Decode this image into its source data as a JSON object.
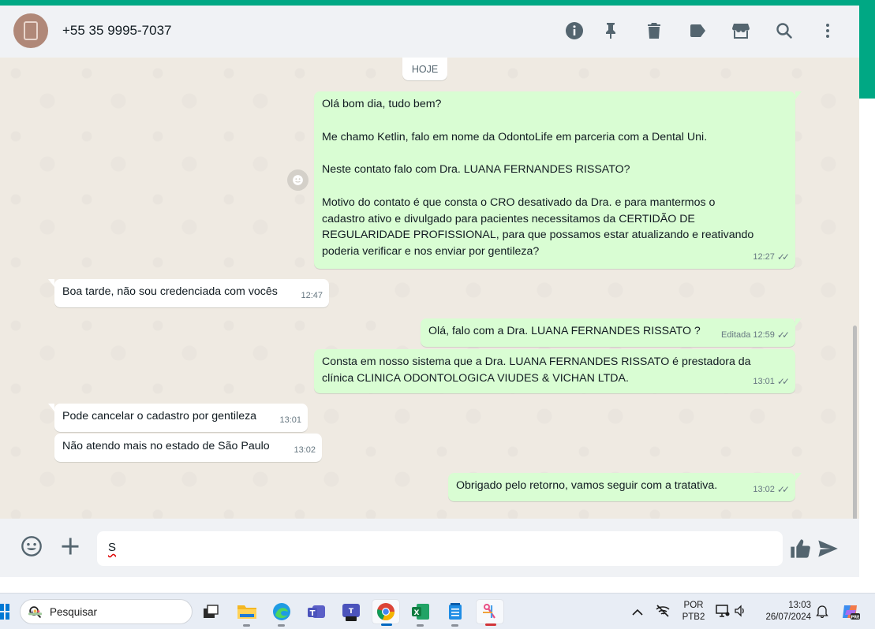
{
  "header": {
    "contact_name": "+55 35 9995-7037",
    "icons": [
      "info-icon",
      "pin-icon",
      "trash-icon",
      "label-icon",
      "store-icon",
      "search-icon",
      "more-menu-icon"
    ]
  },
  "chat": {
    "day_label": "HOJE",
    "messages": [
      {
        "direction": "outgoing",
        "lines": [
          "Olá bom dia, tudo bem?",
          "",
          "Me chamo Ketlin, falo em nome da OdontoLife em parceria com a Dental Uni.",
          "",
          "Neste contato falo com Dra. LUANA FERNANDES RISSATO?",
          "",
          "Motivo do contato é que consta o CRO desativado da Dra. e para mantermos o",
          "cadastro ativo e divulgado para pacientes necessitamos da CERTIDÃO DE",
          "REGULARIDADE PROFISSIONAL, para que possamos estar atualizando e reativando",
          "poderia verificar e nos enviar por gentileza?"
        ],
        "time": "12:27"
      },
      {
        "direction": "incoming",
        "text": "Boa tarde, não sou credenciada com vocês",
        "time": "12:47"
      },
      {
        "direction": "outgoing",
        "text": "Olá, falo com a Dra. LUANA FERNANDES RISSATO ?",
        "edited_label": "Editada",
        "time": "12:59"
      },
      {
        "direction": "outgoing",
        "lines": [
          "Consta em nosso sistema que a Dra. LUANA FERNANDES RISSATO é prestadora da",
          "clínica CLINICA ODONTOLOGICA VIUDES & VICHAN LTDA."
        ],
        "time": "13:01"
      },
      {
        "direction": "incoming",
        "text": "Pode cancelar o cadastro por gentileza",
        "time": "13:01"
      },
      {
        "direction": "incoming",
        "text": "Não atendo mais no estado de São Paulo",
        "time": "13:02"
      },
      {
        "direction": "outgoing",
        "text": "Obrigado pelo retorno, vamos seguir com a tratativa.",
        "time": "13:02"
      }
    ]
  },
  "composer": {
    "value": "S"
  },
  "taskbar": {
    "search_label": "Pesquisar",
    "language_top": "POR",
    "language_bottom": "PTB2",
    "clock_time": "13:03",
    "clock_date": "26/07/2024"
  }
}
